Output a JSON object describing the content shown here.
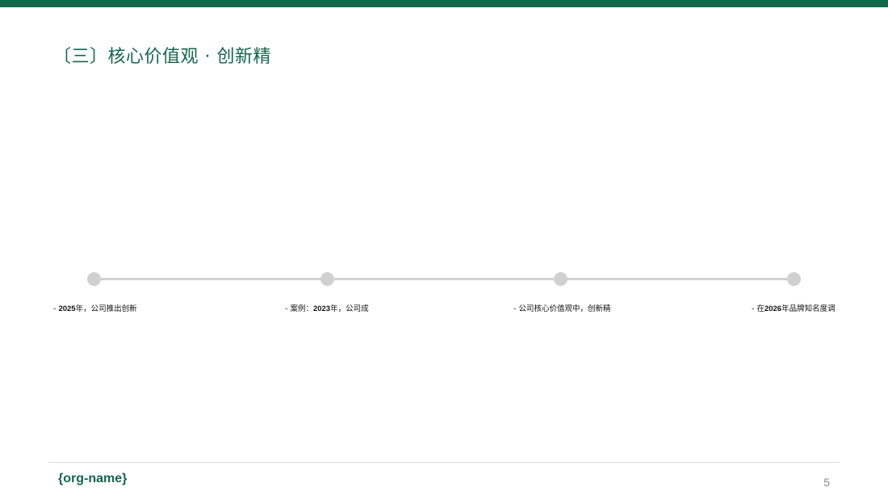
{
  "slide": {
    "title": "〔三〕核心价值观 · 创新精",
    "timeline": [
      {
        "prefix": "- ",
        "year": "2025",
        "text": "年，公司推出创新"
      },
      {
        "prefix": "- 案例：",
        "year": "2023",
        "text": "年，公司成"
      },
      {
        "prefix": "- 公司核心价值观中，创新精",
        "year": "",
        "text": ""
      },
      {
        "prefix": "- 在",
        "year": "2026",
        "text": "年品牌知名度调"
      }
    ],
    "colors": {
      "accent": "#14664a",
      "node": "#d0d0d0",
      "line": "#d2d2d2"
    }
  },
  "footer": {
    "org_name": "{org-name}",
    "page_number": "5"
  }
}
